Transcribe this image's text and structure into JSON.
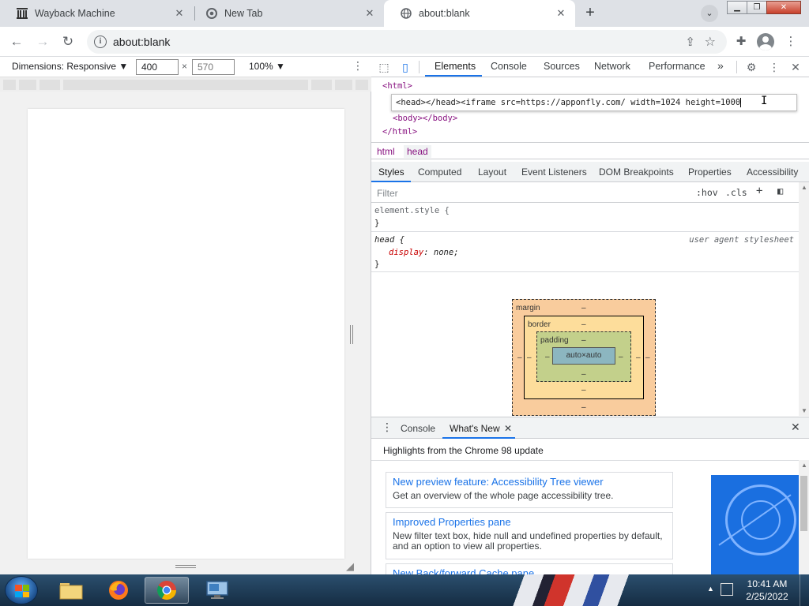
{
  "tabs": [
    {
      "title": "Wayback Machine",
      "icon": "wayback-icon",
      "active": false
    },
    {
      "title": "New Tab",
      "icon": "chrome-icon",
      "active": false
    },
    {
      "title": "about:blank",
      "icon": "globe-icon",
      "active": true
    }
  ],
  "toolbar": {
    "url": "about:blank",
    "back": "←",
    "forward": "→",
    "reload": "↻"
  },
  "device_toolbar": {
    "dimensions_label": "Dimensions: Responsive ▼",
    "width": "400",
    "times": "×",
    "height": "570",
    "zoom": "100% ▼"
  },
  "devtools": {
    "panels": [
      "Elements",
      "Console",
      "Sources",
      "Network",
      "Performance"
    ],
    "more": "»",
    "dom": {
      "html_open": "<html>",
      "edit_text": "<head></head><iframe src=https://apponfly.com/ width=1024 height=1000",
      "body": "<body></body>",
      "html_close": "</html>"
    },
    "breadcrumbs": [
      "html",
      "head"
    ],
    "style_tabs": [
      "Styles",
      "Computed",
      "Layout",
      "Event Listeners",
      "DOM Breakpoints",
      "Properties",
      "Accessibility"
    ],
    "filter_placeholder": "Filter",
    "hov": ":hov",
    "cls": ".cls",
    "rules": {
      "element_style": "element.style {",
      "close": "}",
      "head_selector": "head {",
      "head_source": "user agent stylesheet",
      "head_prop": "display",
      "head_val": " none;"
    },
    "box_model": {
      "margin": "margin",
      "border": "border",
      "padding": "padding",
      "content": "auto×auto",
      "dash": "–"
    },
    "drawer": {
      "tabs": [
        "Console",
        "What's New"
      ],
      "heading": "Highlights from the Chrome 98 update",
      "cards": [
        {
          "title": "New preview feature: Accessibility Tree viewer",
          "desc": "Get an overview of the whole page accessibility tree."
        },
        {
          "title": "Improved Properties pane",
          "desc": "New filter text box, hide null and undefined properties by default, and an option to view all properties."
        },
        {
          "title": "New Back/forward Cache pane",
          "desc": ""
        }
      ]
    }
  },
  "taskbar": {
    "time": "10:41 AM",
    "date": "2/25/2022"
  },
  "colors": {
    "accent": "#1a73e8",
    "tag": "#881280",
    "tabstrip": "#dee1e6"
  }
}
